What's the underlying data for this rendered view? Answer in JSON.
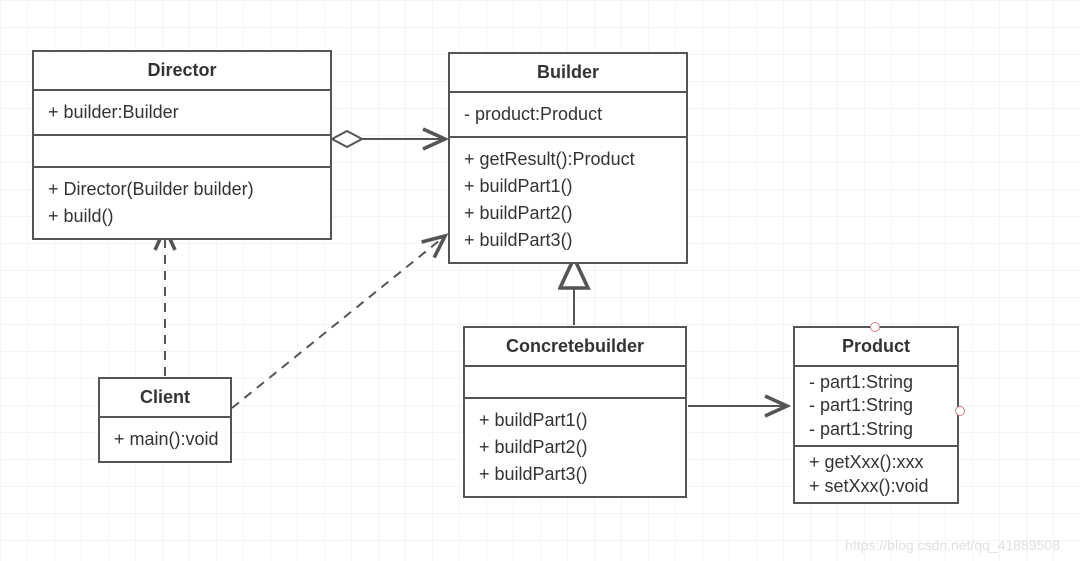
{
  "classes": {
    "director": {
      "name": "Director",
      "attrs": [
        "+ builder:Builder"
      ],
      "spacer": [
        ""
      ],
      "ops": [
        "+ Director(Builder builder)",
        "+ build()"
      ]
    },
    "builder": {
      "name": "Builder",
      "attrs": [
        "- product:Product"
      ],
      "ops": [
        "+ getResult():Product",
        "+ buildPart1()",
        "+ buildPart2()",
        "+ buildPart3()"
      ]
    },
    "client": {
      "name": "Client",
      "ops": [
        "+ main():void"
      ]
    },
    "concretebuilder": {
      "name": "Concretebuilder",
      "ops": [
        "+ buildPart1()",
        "+ buildPart2()",
        "+ buildPart3()"
      ]
    },
    "product": {
      "name": "Product",
      "attrs": [
        "- part1:String",
        "- part1:String",
        "- part1:String"
      ],
      "ops": [
        "+ getXxx():xxx",
        "+ setXxx():void"
      ]
    }
  },
  "watermark": "https://blog.csdn.net/qq_41889508",
  "chart_data": {
    "type": "uml_class_diagram",
    "classes": [
      {
        "name": "Director",
        "attributes": [
          "+ builder:Builder"
        ],
        "operations": [
          "+ Director(Builder builder)",
          "+ build()"
        ]
      },
      {
        "name": "Builder",
        "attributes": [
          "- product:Product"
        ],
        "operations": [
          "+ getResult():Product",
          "+ buildPart1()",
          "+ buildPart2()",
          "+ buildPart3()"
        ]
      },
      {
        "name": "Client",
        "attributes": [],
        "operations": [
          "+ main():void"
        ]
      },
      {
        "name": "Concretebuilder",
        "attributes": [],
        "operations": [
          "+ buildPart1()",
          "+ buildPart2()",
          "+ buildPart3()"
        ]
      },
      {
        "name": "Product",
        "attributes": [
          "- part1:String",
          "- part1:String",
          "- part1:String"
        ],
        "operations": [
          "+ getXxx():xxx",
          "+ setXxx():void"
        ]
      }
    ],
    "relationships": [
      {
        "from": "Director",
        "to": "Builder",
        "type": "aggregation"
      },
      {
        "from": "Client",
        "to": "Director",
        "type": "dependency"
      },
      {
        "from": "Client",
        "to": "Builder",
        "type": "dependency"
      },
      {
        "from": "Concretebuilder",
        "to": "Builder",
        "type": "generalization"
      },
      {
        "from": "Concretebuilder",
        "to": "Product",
        "type": "association"
      }
    ]
  }
}
